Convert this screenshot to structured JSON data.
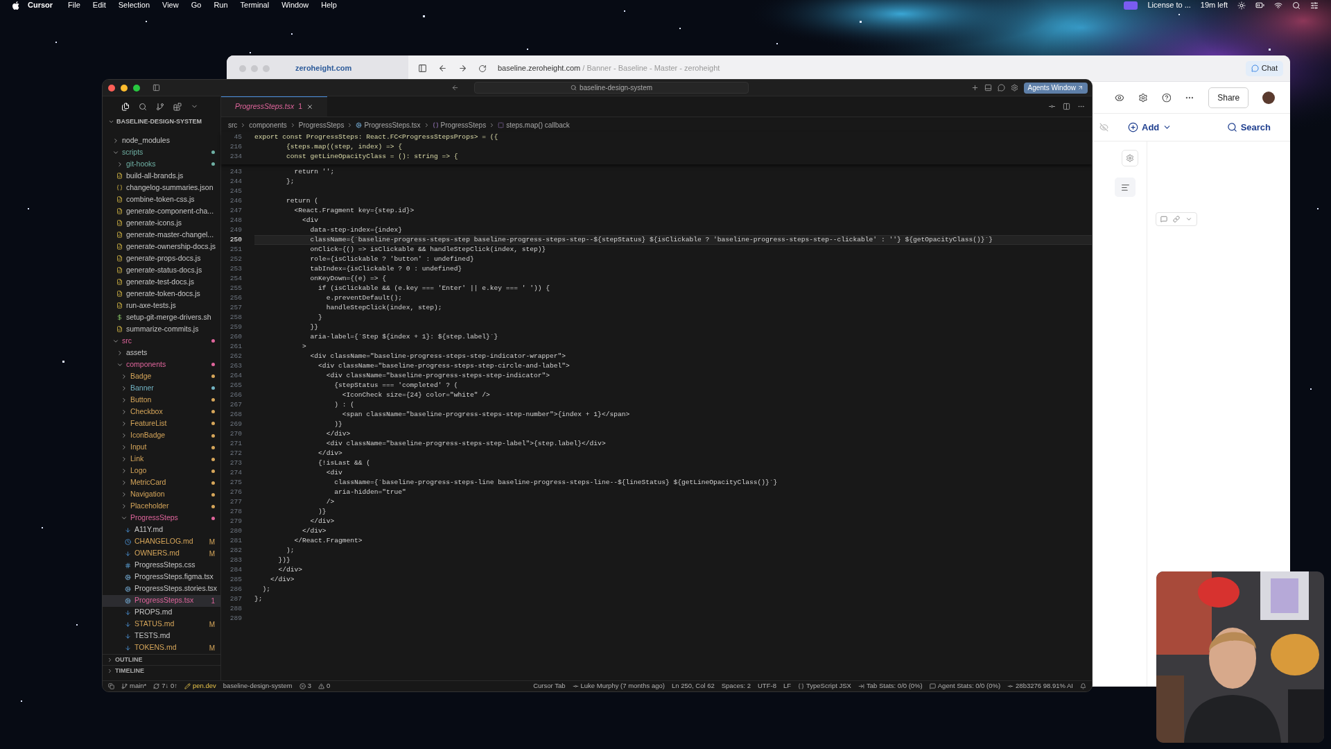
{
  "menu_bar": {
    "app": "Cursor",
    "menus": [
      "File",
      "Edit",
      "Selection",
      "View",
      "Go",
      "Run",
      "Terminal",
      "Window",
      "Help"
    ],
    "status_items": [
      "License to ...",
      "19m left"
    ]
  },
  "browser": {
    "tab_title": "zeroheight.com",
    "url_host": "baseline.zeroheight.com",
    "url_path": "/ Banner - Baseline - Master - zeroheight",
    "chat_button": "Chat",
    "share_button": "Share",
    "add_button": "Add",
    "search_button": "Search"
  },
  "editor_window": {
    "command_center": "baseline-design-system",
    "agents_button": "Agents Window",
    "sidebar": {
      "title": "BASELINE-DESIGN-SYSTEM",
      "items": [
        {
          "label": "node_modules",
          "kind": "folder",
          "expanded": false,
          "selected": false
        },
        {
          "label": "scripts",
          "kind": "folder",
          "expanded": true,
          "selected": false,
          "color": "#6fb0a4",
          "children": [
            {
              "label": "git-hooks",
              "kind": "folder",
              "expanded": false,
              "selected": false,
              "color": "#6fb0a4"
            },
            {
              "label": "build-all-brands.js",
              "kind": "js",
              "selected": false
            },
            {
              "label": "changelog-summaries.json",
              "kind": "json",
              "selected": false
            },
            {
              "label": "combine-token-css.js",
              "kind": "js",
              "selected": false
            },
            {
              "label": "generate-component-cha...",
              "kind": "js",
              "selected": false
            },
            {
              "label": "generate-icons.js",
              "kind": "js",
              "selected": false
            },
            {
              "label": "generate-master-changel...",
              "kind": "js",
              "selected": false
            },
            {
              "label": "generate-ownership-docs.js",
              "kind": "js",
              "selected": false
            },
            {
              "label": "generate-props-docs.js",
              "kind": "js",
              "selected": false
            },
            {
              "label": "generate-status-docs.js",
              "kind": "js",
              "selected": false
            },
            {
              "label": "generate-test-docs.js",
              "kind": "js",
              "selected": false
            },
            {
              "label": "generate-token-docs.js",
              "kind": "js",
              "selected": false
            },
            {
              "label": "run-axe-tests.js",
              "kind": "js",
              "selected": false
            },
            {
              "label": "setup-git-merge-drivers.sh",
              "kind": "shell",
              "selected": false
            },
            {
              "label": "summarize-commits.js",
              "kind": "js",
              "selected": false
            }
          ]
        },
        {
          "label": "src",
          "kind": "folder",
          "expanded": true,
          "selected": false,
          "color": "#e0659c",
          "children": [
            {
              "label": "assets",
              "kind": "folder",
              "expanded": false,
              "selected": false
            },
            {
              "label": "components",
              "kind": "folder",
              "expanded": true,
              "selected": false,
              "color": "#e0659c",
              "children": [
                {
                  "label": "Badge",
                  "kind": "folder",
                  "expanded": false,
                  "selected": false,
                  "color": "#d6a65a"
                },
                {
                  "label": "Banner",
                  "kind": "folder",
                  "expanded": false,
                  "selected": false,
                  "color": "#72b4c4"
                },
                {
                  "label": "Button",
                  "kind": "folder",
                  "expanded": false,
                  "selected": false,
                  "color": "#d6a65a"
                },
                {
                  "label": "Checkbox",
                  "kind": "folder",
                  "expanded": false,
                  "selected": false,
                  "color": "#d6a65a"
                },
                {
                  "label": "FeatureList",
                  "kind": "folder",
                  "expanded": false,
                  "selected": false,
                  "color": "#d6a65a"
                },
                {
                  "label": "IconBadge",
                  "kind": "folder",
                  "expanded": false,
                  "selected": false,
                  "color": "#d6a65a"
                },
                {
                  "label": "Input",
                  "kind": "folder",
                  "expanded": false,
                  "selected": false,
                  "color": "#d6a65a"
                },
                {
                  "label": "Link",
                  "kind": "folder",
                  "expanded": false,
                  "selected": false,
                  "color": "#d6a65a"
                },
                {
                  "label": "Logo",
                  "kind": "folder",
                  "expanded": false,
                  "selected": false,
                  "color": "#d6a65a"
                },
                {
                  "label": "MetricCard",
                  "kind": "folder",
                  "expanded": false,
                  "selected": false,
                  "color": "#d6a65a"
                },
                {
                  "label": "Navigation",
                  "kind": "folder",
                  "expanded": false,
                  "selected": false,
                  "color": "#d6a65a"
                },
                {
                  "label": "Placeholder",
                  "kind": "folder",
                  "expanded": false,
                  "selected": false,
                  "color": "#d6a65a"
                },
                {
                  "label": "ProgressSteps",
                  "kind": "folder",
                  "expanded": true,
                  "selected": false,
                  "color": "#e0659c",
                  "children": [
                    {
                      "label": "A11Y.md",
                      "kind": "markdown",
                      "selected": false
                    },
                    {
                      "label": "CHANGELOG.md",
                      "kind": "history",
                      "selected": false,
                      "color": "#d6a65a",
                      "badge": "M"
                    },
                    {
                      "label": "OWNERS.md",
                      "kind": "markdown",
                      "selected": false,
                      "color": "#d6a65a",
                      "badge": "M"
                    },
                    {
                      "label": "ProgressSteps.css",
                      "kind": "css",
                      "selected": false
                    },
                    {
                      "label": "ProgressSteps.figma.tsx",
                      "kind": "tsx",
                      "selected": false
                    },
                    {
                      "label": "ProgressSteps.stories.tsx",
                      "kind": "tsx",
                      "selected": false
                    },
                    {
                      "label": "ProgressSteps.tsx",
                      "kind": "tsx",
                      "selected": true,
                      "color": "#e0659c",
                      "badge": "1"
                    },
                    {
                      "label": "PROPS.md",
                      "kind": "markdown",
                      "selected": false
                    },
                    {
                      "label": "STATUS.md",
                      "kind": "markdown",
                      "selected": false,
                      "color": "#d6a65a",
                      "badge": "M"
                    },
                    {
                      "label": "TESTS.md",
                      "kind": "markdown",
                      "selected": false
                    },
                    {
                      "label": "TOKENS.md",
                      "kind": "markdown",
                      "selected": false,
                      "color": "#d6a65a",
                      "badge": "M"
                    }
                  ]
                }
              ]
            }
          ]
        }
      ],
      "sections": [
        "OUTLINE",
        "TIMELINE"
      ]
    },
    "tabs": [
      {
        "label": "ProgressSteps.tsx",
        "badge": "1",
        "selected": true
      }
    ],
    "breadcrumb": [
      {
        "label": "src",
        "kind": "plain"
      },
      {
        "label": "components",
        "kind": "plain"
      },
      {
        "label": "ProgressSteps",
        "kind": "plain"
      },
      {
        "label": "ProgressSteps.tsx",
        "kind": "file"
      },
      {
        "label": "ProgressSteps",
        "kind": "variable"
      },
      {
        "label": "steps.map() callback",
        "kind": "function"
      }
    ],
    "sticky_lines": [
      {
        "number": "45",
        "text": "export const ProgressSteps: React.FC<ProgressStepsProps> = ({"
      },
      {
        "number": "216",
        "text": "        {steps.map((step, index) => {"
      },
      {
        "number": "234",
        "text": "        const getLineOpacityClass = (): string => {"
      }
    ],
    "lines": [
      {
        "number": "243",
        "text": "          return '';",
        "current": false
      },
      {
        "number": "244",
        "text": "        };",
        "current": false
      },
      {
        "number": "245",
        "current": false
      },
      {
        "number": "246",
        "text": "        return (",
        "current": false
      },
      {
        "number": "247",
        "text": "          <React.Fragment key={step.id}>",
        "current": false
      },
      {
        "number": "248",
        "text": "            <div",
        "current": false
      },
      {
        "number": "249",
        "text": "              data-step-index={index}",
        "current": false
      },
      {
        "number": "250",
        "text": "              className={`baseline-progress-steps-step baseline-progress-steps-step--${stepStatus} ${isClickable ? 'baseline-progress-steps-step--clickable' : ''} ${getOpacityClass()}`}",
        "current": true
      },
      {
        "number": "251",
        "text": "              onClick={() => isClickable && handleStepClick(index, step)}",
        "current": false
      },
      {
        "number": "252",
        "text": "              role={isClickable ? 'button' : undefined}",
        "current": false
      },
      {
        "number": "253",
        "text": "              tabIndex={isClickable ? 0 : undefined}",
        "current": false
      },
      {
        "number": "254",
        "text": "              onKeyDown={(e) => {",
        "current": false
      },
      {
        "number": "255",
        "text": "                if (isClickable && (e.key === 'Enter' || e.key === ' ')) {",
        "current": false
      },
      {
        "number": "256",
        "text": "                  e.preventDefault();",
        "current": false
      },
      {
        "number": "257",
        "text": "                  handleStepClick(index, step);",
        "current": false
      },
      {
        "number": "258",
        "text": "                }",
        "current": false
      },
      {
        "number": "259",
        "text": "              }}",
        "current": false
      },
      {
        "number": "260",
        "text": "              aria-label={`Step ${index + 1}: ${step.label}`}",
        "current": false
      },
      {
        "number": "261",
        "text": "            >",
        "current": false
      },
      {
        "number": "262",
        "text": "              <div className=\"baseline-progress-steps-step-indicator-wrapper\">",
        "current": false
      },
      {
        "number": "263",
        "text": "                <div className=\"baseline-progress-steps-step-circle-and-label\">",
        "current": false
      },
      {
        "number": "264",
        "text": "                  <div className=\"baseline-progress-steps-step-indicator\">",
        "current": false
      },
      {
        "number": "265",
        "text": "                    {stepStatus === 'completed' ? (",
        "current": false
      },
      {
        "number": "266",
        "text": "                      <IconCheck size={24} color=\"white\" />",
        "current": false
      },
      {
        "number": "267",
        "text": "                    ) : (",
        "current": false
      },
      {
        "number": "268",
        "text": "                      <span className=\"baseline-progress-steps-step-number\">{index + 1}</span>",
        "current": false
      },
      {
        "number": "269",
        "text": "                    )}",
        "current": false
      },
      {
        "number": "270",
        "text": "                  </div>",
        "current": false
      },
      {
        "number": "271",
        "text": "                  <div className=\"baseline-progress-steps-step-label\">{step.label}</div>",
        "current": false
      },
      {
        "number": "272",
        "text": "                </div>",
        "current": false
      },
      {
        "number": "273",
        "text": "                {!isLast && (",
        "current": false
      },
      {
        "number": "274",
        "text": "                  <div",
        "current": false
      },
      {
        "number": "275",
        "text": "                    className={`baseline-progress-steps-line baseline-progress-steps-line--${lineStatus} ${getLineOpacityClass()}`}",
        "current": false
      },
      {
        "number": "276",
        "text": "                    aria-hidden=\"true\"",
        "current": false
      },
      {
        "number": "277",
        "text": "                  />",
        "current": false
      },
      {
        "number": "278",
        "text": "                )}",
        "current": false
      },
      {
        "number": "279",
        "text": "              </div>",
        "current": false
      },
      {
        "number": "280",
        "text": "            </div>",
        "current": false
      },
      {
        "number": "281",
        "text": "          </React.Fragment>",
        "current": false
      },
      {
        "number": "282",
        "text": "        );",
        "current": false
      },
      {
        "number": "283",
        "text": "      })}",
        "current": false
      },
      {
        "number": "284",
        "text": "      </div>",
        "current": false
      },
      {
        "number": "285",
        "text": "    </div>",
        "current": false
      },
      {
        "number": "286",
        "text": "  );",
        "current": false
      },
      {
        "number": "287",
        "text": "};",
        "current": false
      },
      {
        "number": "288",
        "current": false
      },
      {
        "number": "289",
        "current": false
      }
    ],
    "status_bar": {
      "left": [
        {
          "kind": "branch",
          "text": "main*"
        },
        {
          "kind": "sync",
          "text": "7↓ 0↑"
        },
        {
          "kind": "pen",
          "text": "pen.dev"
        },
        {
          "kind": "plain",
          "text": "baseline-design-system"
        },
        {
          "kind": "errors",
          "text": "3"
        },
        {
          "kind": "warnings",
          "text": "0"
        }
      ],
      "right": [
        {
          "kind": "plain",
          "text": "Cursor Tab"
        },
        {
          "kind": "commit",
          "text": "Luke Murphy (7 months ago)"
        },
        {
          "kind": "plain",
          "text": "Ln 250, Col 62"
        },
        {
          "kind": "plain",
          "text": "Spaces: 2"
        },
        {
          "kind": "plain",
          "text": "UTF-8"
        },
        {
          "kind": "plain",
          "text": "LF"
        },
        {
          "kind": "braces",
          "text": "TypeScript JSX"
        },
        {
          "kind": "tab",
          "text": "Tab Stats: 0/0 (0%)"
        },
        {
          "kind": "agent",
          "text": "Agent Stats: 0/0 (0%)"
        },
        {
          "kind": "commit",
          "text": "28b3276 98.91% AI"
        }
      ]
    }
  }
}
